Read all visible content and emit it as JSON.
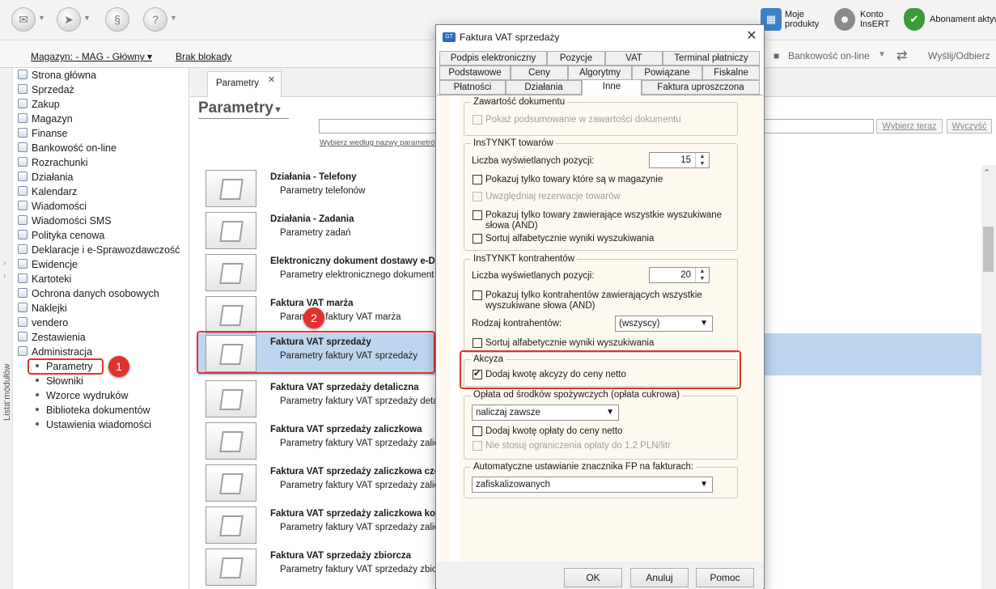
{
  "toolbar": {
    "moje_produkty": "Moje\nprodukty",
    "konto_line1": "Konto",
    "konto_line2": "InsERT",
    "abonament": "Abonament aktyw"
  },
  "bar2": {
    "magazyn": "Magazyn: - MAG - Główny ▾",
    "brak_blokady": "Brak blokady",
    "bankowosc": "Bankowość on-line",
    "wyslij_odbierz": "Wyślij/Odbierz"
  },
  "sidebar": {
    "vertical_label": "Lista modułów",
    "items": [
      {
        "label": "Strona główna"
      },
      {
        "label": "Sprzedaż"
      },
      {
        "label": "Zakup"
      },
      {
        "label": "Magazyn"
      },
      {
        "label": "Finanse"
      },
      {
        "label": "Bankowość on-line"
      },
      {
        "label": "Rozrachunki"
      },
      {
        "label": "Działania"
      },
      {
        "label": "Kalendarz"
      },
      {
        "label": "Wiadomości"
      },
      {
        "label": "Wiadomości SMS"
      },
      {
        "label": "Polityka cenowa"
      },
      {
        "label": "Deklaracje i e-Sprawozdawczość"
      },
      {
        "label": "Ewidencje"
      },
      {
        "label": "Kartoteki"
      },
      {
        "label": "Ochrona danych osobowych"
      },
      {
        "label": "Naklejki"
      },
      {
        "label": "vendero"
      },
      {
        "label": "Zestawienia"
      },
      {
        "label": "Administracja"
      }
    ],
    "subitems": [
      {
        "label": "Parametry"
      },
      {
        "label": "Słowniki"
      },
      {
        "label": "Wzorce wydruków"
      },
      {
        "label": "Biblioteka dokumentów"
      },
      {
        "label": "Ustawienia wiadomości"
      }
    ]
  },
  "main": {
    "tab_label": "Parametry",
    "tab_close": "✕",
    "page_title": "Parametry",
    "search_hint": "Wybierz według nazwy parametrów",
    "btn_wybierz": "Wybierz teraz",
    "btn_wyczysc": "Wyczyść",
    "rows": [
      {
        "title": "Działania - Telefony",
        "desc": "Parametry telefonów"
      },
      {
        "title": "Działania - Zadania",
        "desc": "Parametry zadań"
      },
      {
        "title": "Elektroniczny dokument dostawy e-DD",
        "desc": "Parametry elektronicznego dokument"
      },
      {
        "title": "Faktura VAT marża",
        "desc": "Parametry faktury VAT marża"
      },
      {
        "title": "Faktura VAT sprzedaży",
        "desc": "Parametry faktury VAT sprzedaży"
      },
      {
        "title": "Faktura VAT sprzedaży detaliczna",
        "desc": "Parametry faktury VAT sprzedaży detal"
      },
      {
        "title": "Faktura VAT sprzedaży zaliczkowa",
        "desc": "Parametry faktury VAT sprzedaży zalic"
      },
      {
        "title": "Faktura VAT sprzedaży zaliczkowa częśt",
        "desc": "Parametry faktury VAT sprzedaży zalic"
      },
      {
        "title": "Faktura VAT sprzedaży zaliczkowa końc",
        "desc": "Parametry faktury VAT sprzedaży zalic"
      },
      {
        "title": "Faktura VAT sprzedaży zbiorcza",
        "desc": "Parametry faktury VAT sprzedaży zbior"
      }
    ]
  },
  "badges": {
    "one": "1",
    "two": "2"
  },
  "dialog": {
    "title": "Faktura VAT sprzedaży",
    "close": "✕",
    "app_icon": "GT",
    "tabs_row1": [
      "Podpis elektroniczny",
      "Pozycje",
      "VAT",
      "Terminal płatniczy"
    ],
    "tabs_row2": [
      "Podstawowe",
      "Ceny",
      "Algorytmy",
      "Powiązane",
      "Fiskalne"
    ],
    "tabs_row3": [
      "Płatności",
      "Działania",
      "Inne",
      "Faktura uproszczona"
    ],
    "zawartosc": {
      "legend": "Zawartość dokumentu",
      "pokaz": "Pokaż podsumowanie w zawartości dokumentu"
    },
    "towary": {
      "legend": "InsTYNKT towarów",
      "liczba_label": "Liczba wyświetlanych pozycji:",
      "liczba_val": "15",
      "opt1": "Pokazuj tylko towary które są w magazynie",
      "opt2": "Uwzględniaj rezerwacje towarów",
      "opt3_line1": "Pokazuj tylko towary zawierające wszystkie wyszukiwane",
      "opt3_line2": "słowa (AND)",
      "opt4": "Sortuj alfabetycznie wyniki wyszukiwania"
    },
    "kontrahenci": {
      "legend": "InsTYNKT kontrahentów",
      "liczba_label": "Liczba wyświetlanych pozycji:",
      "liczba_val": "20",
      "opt1_line1": "Pokazuj tylko kontrahentów zawierających wszystkie",
      "opt1_line2": "wyszukiwane słowa (AND)",
      "rodzaj_label": "Rodzaj kontrahentów:",
      "rodzaj_val": "(wszyscy)",
      "opt2": "Sortuj alfabetycznie wyniki wyszukiwania"
    },
    "akcyza": {
      "legend": "Akcyza",
      "opt1": "Dodaj kwotę akcyzy do ceny netto"
    },
    "oplata": {
      "legend": "Opłata od środków spożywczych (opłata cukrowa)",
      "combo_val": "naliczaj zawsze",
      "opt1": "Dodaj kwotę opłaty do ceny netto",
      "opt2": "Nie stosuj ograniczenia opłaty do 1.2 PLN/litr"
    },
    "fp": {
      "legend": "Automatyczne ustawianie znacznika FP na fakturach:",
      "combo_val": "zafiskalizowanych"
    },
    "buttons": {
      "ok": "OK",
      "anuluj": "Anuluj",
      "pomoc": "Pomoc"
    }
  }
}
